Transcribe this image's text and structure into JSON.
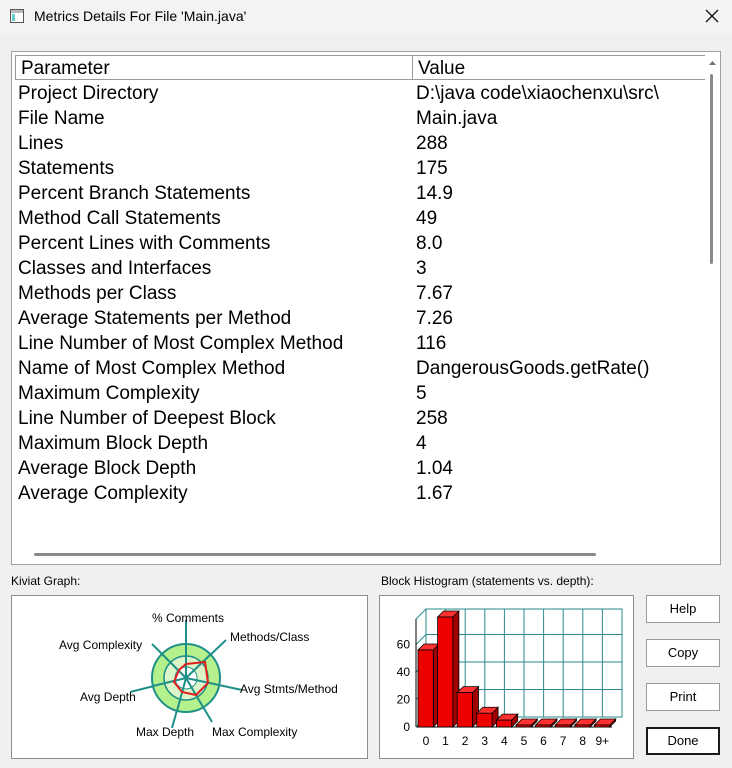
{
  "window": {
    "title": "Metrics Details For File 'Main.java'"
  },
  "table": {
    "headers": {
      "parameter": "Parameter",
      "value": "Value"
    },
    "rows": [
      {
        "name": "Project Directory",
        "value": "D:\\java code\\xiaochenxu\\src\\"
      },
      {
        "name": "File Name",
        "value": "Main.java"
      },
      {
        "name": "Lines",
        "value": "288"
      },
      {
        "name": "Statements",
        "value": "175"
      },
      {
        "name": "Percent Branch Statements",
        "value": "14.9"
      },
      {
        "name": "Method Call Statements",
        "value": "49"
      },
      {
        "name": "Percent Lines with Comments",
        "value": "8.0"
      },
      {
        "name": "Classes and Interfaces",
        "value": "3"
      },
      {
        "name": "Methods per Class",
        "value": "7.67"
      },
      {
        "name": "Average Statements per Method",
        "value": "7.26"
      },
      {
        "name": "Line Number of Most Complex Method",
        "value": "116"
      },
      {
        "name": "Name of Most Complex Method",
        "value": "DangerousGoods.getRate()"
      },
      {
        "name": "Maximum Complexity",
        "value": "5"
      },
      {
        "name": "Line Number of Deepest Block",
        "value": "258"
      },
      {
        "name": "Maximum Block Depth",
        "value": "4"
      },
      {
        "name": "Average Block Depth",
        "value": "1.04"
      },
      {
        "name": "Average Complexity",
        "value": "1.67"
      }
    ]
  },
  "kiviat": {
    "label": "Kiviat Graph:",
    "axes": {
      "comments": "% Comments",
      "methods_class": "Methods/Class",
      "avg_stmts": "Avg Stmts/Method",
      "max_complexity": "Max Complexity",
      "max_depth": "Max Depth",
      "avg_depth": "Avg Depth",
      "avg_complexity": "Avg Complexity"
    },
    "colors": {
      "outer_ring": "#b4f08c",
      "inner_ring": "#dcf5c8",
      "axis": "#1e9088",
      "shape": "#e02020"
    }
  },
  "chart_data": {
    "type": "bar",
    "title": "Block Histogram (statements vs. depth):",
    "categories": [
      "0",
      "1",
      "2",
      "3",
      "4",
      "5",
      "6",
      "7",
      "8",
      "9+"
    ],
    "values": [
      56,
      80,
      25,
      10,
      5,
      1,
      1,
      1,
      1,
      1
    ],
    "yticks": [
      "0",
      "20",
      "40",
      "60"
    ],
    "ylim": [
      0,
      80
    ],
    "colors": {
      "bar": "#ee0000",
      "grid": "#2a8a8a"
    }
  },
  "buttons": {
    "help": "Help",
    "copy": "Copy",
    "print": "Print",
    "done": "Done"
  }
}
